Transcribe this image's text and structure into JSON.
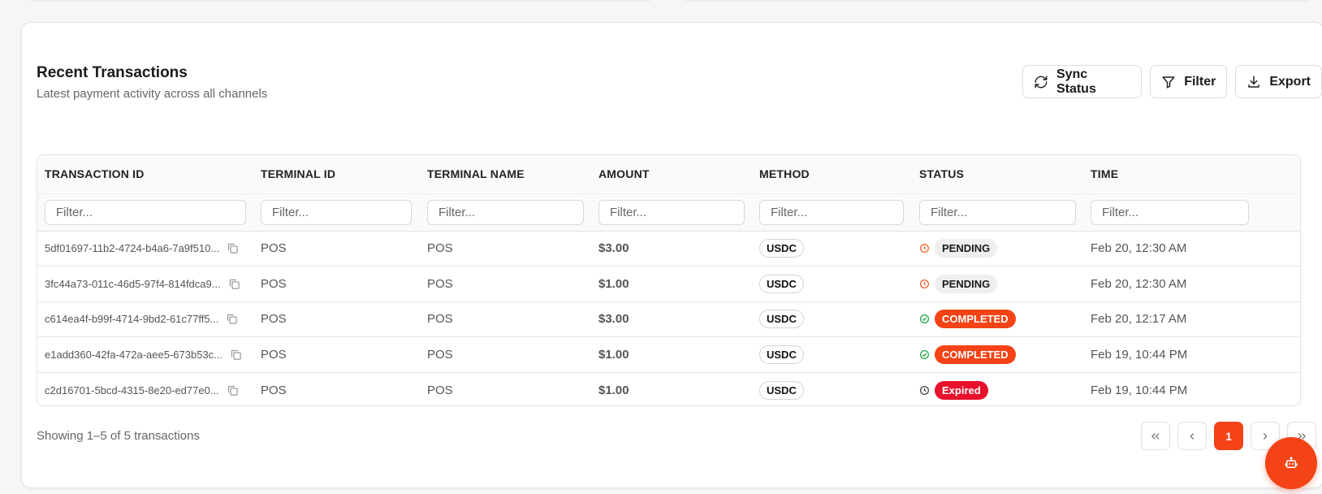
{
  "header": {
    "title": "Recent Transactions",
    "subtitle": "Latest payment activity across all channels"
  },
  "actions": {
    "sync_label": "Sync Status",
    "filter_label": "Filter",
    "export_label": "Export"
  },
  "table": {
    "columns": [
      "TRANSACTION ID",
      "TERMINAL ID",
      "TERMINAL NAME",
      "AMOUNT",
      "METHOD",
      "STATUS",
      "TIME"
    ],
    "filter_placeholder": "Filter...",
    "rows": [
      {
        "id": "5df01697-11b2-4724-b4a6-7a9f510...",
        "terminal_id": "POS",
        "terminal_name": "POS",
        "amount": "$3.00",
        "method": "USDC",
        "status": "PENDING",
        "time": "Feb 20, 12:30 AM"
      },
      {
        "id": "3fc44a73-011c-46d5-97f4-814fdca9...",
        "terminal_id": "POS",
        "terminal_name": "POS",
        "amount": "$1.00",
        "method": "USDC",
        "status": "PENDING",
        "time": "Feb 20, 12:30 AM"
      },
      {
        "id": "c614ea4f-b99f-4714-9bd2-61c77ff5...",
        "terminal_id": "POS",
        "terminal_name": "POS",
        "amount": "$3.00",
        "method": "USDC",
        "status": "COMPLETED",
        "time": "Feb 20, 12:17 AM"
      },
      {
        "id": "e1add360-42fa-472a-aee5-673b53c...",
        "terminal_id": "POS",
        "terminal_name": "POS",
        "amount": "$1.00",
        "method": "USDC",
        "status": "COMPLETED",
        "time": "Feb 19, 10:44 PM"
      },
      {
        "id": "c2d16701-5bcd-4315-8e20-ed77e0...",
        "terminal_id": "POS",
        "terminal_name": "POS",
        "amount": "$1.00",
        "method": "USDC",
        "status": "Expired",
        "time": "Feb 19, 10:44 PM"
      }
    ]
  },
  "footer": {
    "showing_text": "Showing 1–5 of 5 transactions",
    "current_page": "1"
  },
  "colors": {
    "accent": "#f44316",
    "expired": "#e8102b",
    "pending_icon": "#f0622a",
    "completed_icon": "#22a447",
    "expired_icon": "#444444"
  },
  "icons": {
    "sync": "refresh-icon",
    "filter": "funnel-icon",
    "export": "download-icon",
    "copy": "copy-icon",
    "pending": "clock-icon",
    "completed": "check-circle-icon",
    "expired": "clock-icon",
    "fab": "robot-icon"
  }
}
